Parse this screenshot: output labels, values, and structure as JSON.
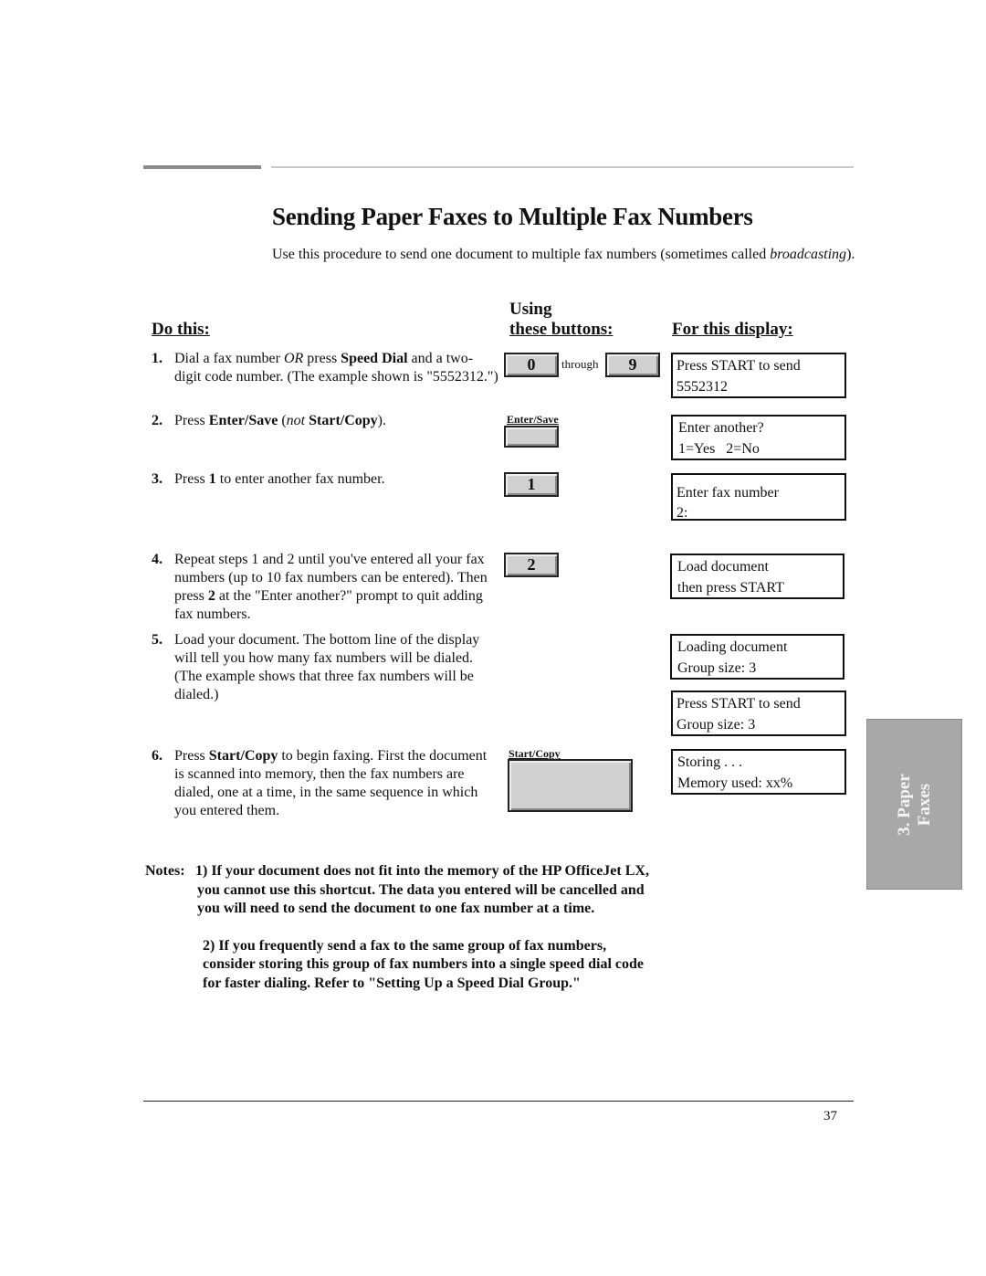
{
  "page": {
    "title": "Sending Paper Faxes to Multiple Fax Numbers",
    "intro": "Use this procedure to send one document to multiple fax numbers (sometimes called ",
    "intro_italic": "broadcasting",
    "intro_end": ").",
    "page_number": "37"
  },
  "headers": {
    "do_this": "Do this:",
    "using_line1": "Using",
    "using_line2": "these buttons:",
    "display": "For this display:"
  },
  "steps": [
    {
      "num": "1.",
      "parts": [
        [
          "t",
          "Dial a fax number "
        ],
        [
          "i",
          "OR"
        ],
        [
          "t",
          " press "
        ],
        [
          "b",
          "Speed Dial"
        ],
        [
          "t",
          " and a two-digit code number. (The example shown is \"5552312.\")"
        ]
      ]
    },
    {
      "num": "2.",
      "parts": [
        [
          "t",
          "Press "
        ],
        [
          "b",
          "Enter/Save"
        ],
        [
          "t",
          " ("
        ],
        [
          "i",
          "not"
        ],
        [
          "t",
          " "
        ],
        [
          "b",
          "Start/Copy"
        ],
        [
          "t",
          ")."
        ]
      ]
    },
    {
      "num": "3.",
      "parts": [
        [
          "t",
          "Press "
        ],
        [
          "b",
          "1"
        ],
        [
          "t",
          " to enter another fax number."
        ]
      ]
    },
    {
      "num": "4.",
      "parts": [
        [
          "t",
          "Repeat steps 1 and 2 until you've entered all your fax numbers (up to 10 fax numbers can be entered). Then press "
        ],
        [
          "b",
          "2"
        ],
        [
          "t",
          " at the \"Enter another?\" prompt to quit adding fax numbers."
        ]
      ]
    },
    {
      "num": "5.",
      "parts": [
        [
          "t",
          "Load your document. The bottom line of the display will tell you how many fax numbers will be dialed. (The example shows that three fax numbers will be dialed.)"
        ]
      ]
    },
    {
      "num": "6.",
      "parts": [
        [
          "t",
          "Press "
        ],
        [
          "b",
          "Start/Copy"
        ],
        [
          "t",
          " to begin faxing. First the document is scanned into memory, then the fax numbers are dialed, one at a time, in the same sequence in which you entered them."
        ]
      ]
    }
  ],
  "buttons": {
    "key_0": "0",
    "through": "through",
    "key_9": "9",
    "enter_save_label": "Enter/Save",
    "key_1": "1",
    "key_2": "2",
    "start_copy_label": "Start/Copy"
  },
  "displays": [
    {
      "line1": "Press START to send",
      "line2": "5552312"
    },
    {
      "line1": "Enter another?",
      "line2": "1=Yes   2=No"
    },
    {
      "line1": "Enter fax number",
      "line2": "2:"
    },
    {
      "line1": "Load document",
      "line2": "then press START"
    },
    {
      "line1": "Loading document",
      "line2": "Group size: 3"
    },
    {
      "line1": "Press START to send",
      "line2": "Group size: 3"
    },
    {
      "line1": "Storing . . .",
      "line2": "Memory used: xx%"
    }
  ],
  "notes": {
    "label": "Notes:",
    "note1": "1) If your document does not fit into the memory of the HP OfficeJet LX, you cannot use this shortcut. The data you entered will be cancelled and you will need to send the document to one fax number at a time.",
    "note2": "2) If you frequently send a fax to the same group of fax numbers, consider storing this group of fax numbers into a single speed dial code for faster dialing. Refer to \"Setting Up a Speed Dial Group.\""
  },
  "side_tab": {
    "line1": "3. Paper",
    "line2": "Faxes"
  }
}
